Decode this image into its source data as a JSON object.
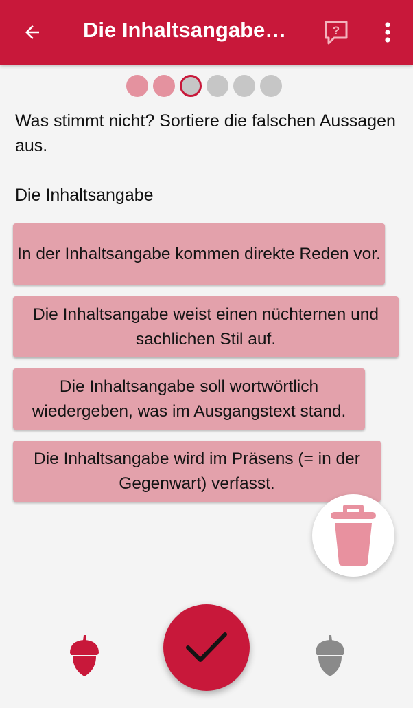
{
  "appbar": {
    "title": "Die Inhaltsangabe…",
    "back_icon": "arrow-left-icon",
    "help_icon": "help-message-icon",
    "more_icon": "more-vertical-icon"
  },
  "progress": {
    "total": 6,
    "current": 3,
    "states": [
      "done",
      "done",
      "current",
      "todo",
      "todo",
      "todo"
    ]
  },
  "question": "Was stimmt nicht? Sortiere die falschen Aussagen aus.",
  "subtitle": "Die Inhaltsangabe",
  "cards": [
    {
      "text": "In der Inhaltsangabe kommen direkte Reden vor."
    },
    {
      "text": "Die Inhaltsangabe weist einen nüchternen und sachlichen Stil auf."
    },
    {
      "text": "Die Inhaltsangabe soll wortwörtlich wiedergeben, was im Ausgangstext stand."
    },
    {
      "text": "Die Inhaltsangabe wird im Präsens (= in der Gegenwart) verfasst."
    }
  ],
  "actions": {
    "trash_icon": "trash-can-icon",
    "check_icon": "checkmark-icon",
    "acorn_left_icon": "acorn-icon",
    "acorn_right_icon": "acorn-icon"
  },
  "colors": {
    "primary": "#c8183a",
    "card": "#e3a1ab",
    "dot_done": "#e4929f",
    "dot_todo": "#c6c6c6",
    "trash": "#e8919f",
    "acorn_active": "#c8183a",
    "acorn_inactive": "#8a8a8a",
    "background": "#f4f4f4"
  }
}
